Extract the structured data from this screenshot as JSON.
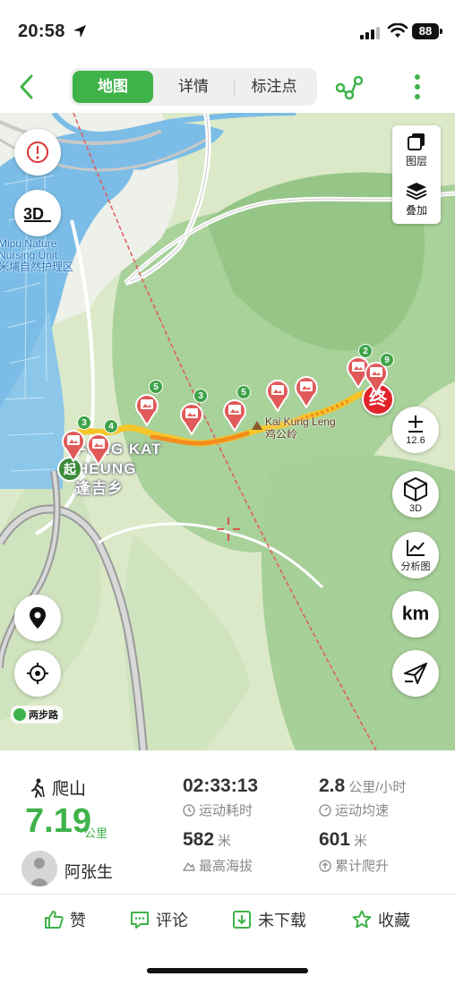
{
  "status": {
    "time": "20:58",
    "battery": "88"
  },
  "nav": {
    "tabs": [
      "地图",
      "详情",
      "标注点"
    ],
    "active_tab": 0
  },
  "map": {
    "labels": {
      "nature_en": "Mipu Nature\nNursing Unit",
      "nature_zh": "米埔自然护理区",
      "place_en_1": "FUNG KAT",
      "place_en_2": "HEUNG",
      "place_zh": "逢吉乡",
      "peak_en": "Kai Kung Leng",
      "peak_zh": "鸡公岭",
      "start_marker": "起",
      "end_marker": "终"
    },
    "photo_pin_counts": [
      "3",
      "4",
      "5",
      "3",
      "5",
      "2",
      "9"
    ],
    "controls": {
      "layers": "图层",
      "overlay": "叠加",
      "zoom_level": "12.6",
      "view_3d": "3D",
      "analysis": "分析图",
      "unit": "km",
      "brand": "两步路"
    }
  },
  "activity": {
    "type": "爬山",
    "distance": "7.19",
    "distance_unit": "公里",
    "user": "阿张生",
    "duration": "02:33:13",
    "duration_label": "运动耗时",
    "avg_speed": "2.8",
    "avg_speed_unit": "公里/小时",
    "avg_speed_label": "运动均速",
    "max_alt": "582",
    "max_alt_unit": "米",
    "max_alt_label": "最高海拔",
    "climb": "601",
    "climb_unit": "米",
    "climb_label": "累计爬升"
  },
  "actions": {
    "like": "赞",
    "comment": "评论",
    "download": "未下载",
    "favorite": "收藏"
  },
  "colors": {
    "accent": "#3fb34a",
    "end_marker": "#e0242a",
    "pin": "#e05a5a"
  }
}
